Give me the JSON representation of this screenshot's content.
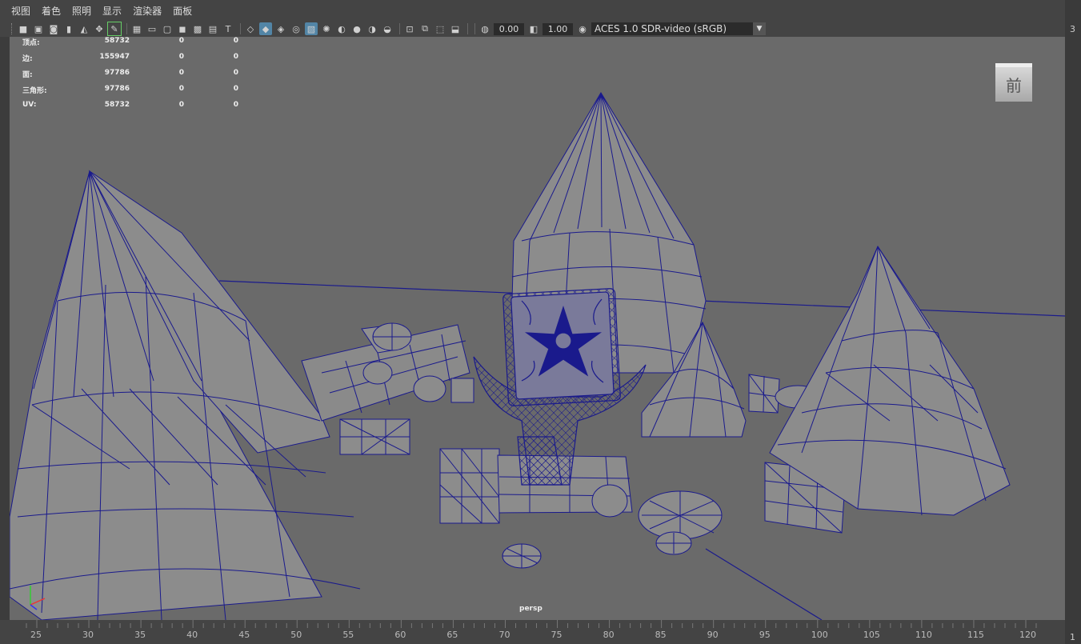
{
  "menubar": {
    "items": [
      "视图",
      "着色",
      "照明",
      "显示",
      "渲染器",
      "面板"
    ]
  },
  "toolbar": {
    "icons": [
      "camera-icon",
      "camera-lock-icon",
      "camera-attr-icon",
      "bookmark-icon",
      "image-plane-icon",
      "2d-pan-icon",
      "grease-pencil-icon",
      "grid-icon",
      "film-gate-icon",
      "resolution-gate-icon",
      "gate-mask-icon",
      "field-chart-icon",
      "safe-action-icon",
      "safe-title-icon",
      "wireframe-icon",
      "smooth-shade-icon",
      "wireframe-on-shaded-icon",
      "xray-icon",
      "textured-icon",
      "lights-icon",
      "shadows-icon",
      "ambient-occlusion-icon",
      "motion-blur-icon",
      "anti-alias-icon",
      "isolate-select-icon",
      "xray-joints-icon",
      "xray-active-icon",
      "backface-icon",
      "exposure-icon",
      "gamma-icon",
      "color-management-icon"
    ],
    "exposure_value": "0.00",
    "gamma_value": "1.00",
    "color_space": "ACES 1.0 SDR-video (sRGB)"
  },
  "hud": {
    "rows": [
      {
        "label": "顶点:",
        "v1": "58732",
        "v2": "0",
        "v3": "0"
      },
      {
        "label": "边:",
        "v1": "155947",
        "v2": "0",
        "v3": "0"
      },
      {
        "label": "面:",
        "v1": "97786",
        "v2": "0",
        "v3": "0"
      },
      {
        "label": "三角形:",
        "v1": "97786",
        "v2": "0",
        "v3": "0"
      },
      {
        "label": "UV:",
        "v1": "58732",
        "v2": "0",
        "v3": "0"
      }
    ]
  },
  "viewport": {
    "camera": "persp",
    "viewcube_face": "前"
  },
  "timeline": {
    "ticks": [
      "25",
      "30",
      "35",
      "40",
      "45",
      "50",
      "55",
      "60",
      "65",
      "70",
      "75",
      "80",
      "85",
      "90",
      "95",
      "100",
      "105",
      "110",
      "115",
      "120"
    ]
  },
  "right_strip": {
    "top_digit": "3",
    "bottom_digit": "1"
  },
  "colors": {
    "wire": "#1a1a8c",
    "mesh_fill": "#8c8c8c",
    "viewport_bg": "#6a6a6a",
    "accent": "#5285a6"
  }
}
